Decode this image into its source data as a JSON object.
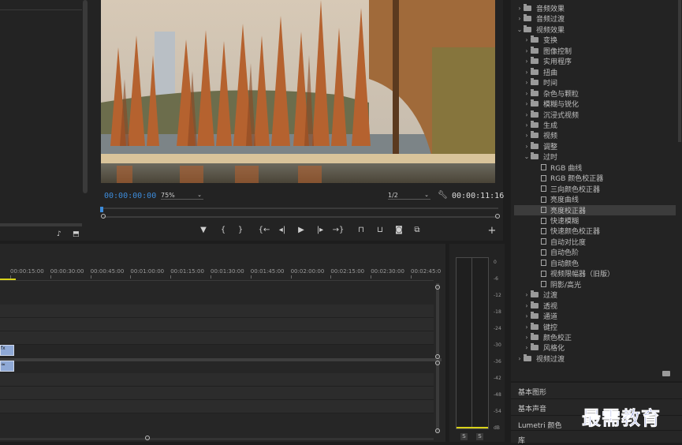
{
  "program_monitor": {
    "timecode_current": "00:00:00:00",
    "zoom_level": "75%",
    "resolution": "1/2",
    "timecode_duration": "00:00:11:16",
    "playhead_fraction": 0.0,
    "controls": {
      "marker": "▼",
      "in": "{",
      "out": "}",
      "goto_in": "{←",
      "step_back": "◂|",
      "play": "▶",
      "step_forward": "|▸",
      "goto_out": "→}",
      "lift": "⊓",
      "extract": "⊔",
      "export_frame": "◙",
      "compare": "⧉",
      "add": "+"
    }
  },
  "timeline": {
    "ruler_labels": [
      "00:00:15:00",
      "00:00:30:00",
      "00:00:45:00",
      "00:01:00:00",
      "00:01:15:00",
      "00:01:30:00",
      "00:01:45:00",
      "00:02:00:00",
      "00:02:15:00",
      "00:02:30:00",
      "00:02:45:0"
    ],
    "clip_video_label": "fx",
    "clip_audio_label": "≈"
  },
  "audio_meter": {
    "scale": [
      "0",
      "-6",
      "-12",
      "-18",
      "-24",
      "-30",
      "-36",
      "-42",
      "-48",
      "-54",
      "dB"
    ],
    "solo_left": "S",
    "solo_right": "S"
  },
  "effects_panel": {
    "items": [
      {
        "label": "音频效果",
        "level": 0,
        "type": "folder",
        "expanded": false
      },
      {
        "label": "音频过渡",
        "level": 0,
        "type": "folder",
        "expanded": false
      },
      {
        "label": "视频效果",
        "level": 0,
        "type": "folder",
        "expanded": true
      },
      {
        "label": "变换",
        "level": 1,
        "type": "folder",
        "expanded": false
      },
      {
        "label": "图像控制",
        "level": 1,
        "type": "folder",
        "expanded": false
      },
      {
        "label": "实用程序",
        "level": 1,
        "type": "folder",
        "expanded": false
      },
      {
        "label": "扭曲",
        "level": 1,
        "type": "folder",
        "expanded": false
      },
      {
        "label": "时间",
        "level": 1,
        "type": "folder",
        "expanded": false
      },
      {
        "label": "杂色与颗粒",
        "level": 1,
        "type": "folder",
        "expanded": false
      },
      {
        "label": "模糊与锐化",
        "level": 1,
        "type": "folder",
        "expanded": false
      },
      {
        "label": "沉浸式视频",
        "level": 1,
        "type": "folder",
        "expanded": false
      },
      {
        "label": "生成",
        "level": 1,
        "type": "folder",
        "expanded": false
      },
      {
        "label": "视频",
        "level": 1,
        "type": "folder",
        "expanded": false
      },
      {
        "label": "调整",
        "level": 1,
        "type": "folder",
        "expanded": false
      },
      {
        "label": "过时",
        "level": 1,
        "type": "folder",
        "expanded": true
      },
      {
        "label": "RGB 曲线",
        "level": 2,
        "type": "effect"
      },
      {
        "label": "RGB 颜色校正器",
        "level": 2,
        "type": "effect"
      },
      {
        "label": "三向颜色校正器",
        "level": 2,
        "type": "effect"
      },
      {
        "label": "亮度曲线",
        "level": 2,
        "type": "effect"
      },
      {
        "label": "亮度校正器",
        "level": 2,
        "type": "effect",
        "selected": true
      },
      {
        "label": "快速模糊",
        "level": 2,
        "type": "effect"
      },
      {
        "label": "快速颜色校正器",
        "level": 2,
        "type": "effect"
      },
      {
        "label": "自动对比度",
        "level": 2,
        "type": "effect"
      },
      {
        "label": "自动色阶",
        "level": 2,
        "type": "effect"
      },
      {
        "label": "自动颜色",
        "level": 2,
        "type": "effect"
      },
      {
        "label": "视频限幅器（旧版）",
        "level": 2,
        "type": "effect"
      },
      {
        "label": "阴影/高光",
        "level": 2,
        "type": "effect"
      },
      {
        "label": "过渡",
        "level": 1,
        "type": "folder",
        "expanded": false
      },
      {
        "label": "透视",
        "level": 1,
        "type": "folder",
        "expanded": false
      },
      {
        "label": "通道",
        "level": 1,
        "type": "folder",
        "expanded": false
      },
      {
        "label": "键控",
        "level": 1,
        "type": "folder",
        "expanded": false
      },
      {
        "label": "颜色校正",
        "level": 1,
        "type": "folder",
        "expanded": false
      },
      {
        "label": "风格化",
        "level": 1,
        "type": "folder",
        "expanded": false
      },
      {
        "label": "视频过渡",
        "level": 0,
        "type": "folder",
        "expanded": false
      }
    ]
  },
  "side_panels": [
    "基本图形",
    "基本声音",
    "Lumetri 颜色",
    "库"
  ],
  "watermark": "最需教育",
  "colors": {
    "accent_blue": "#3d8bd9",
    "selected_row": "#3c3c3c",
    "clip_blue": "#8fa9d6",
    "playhead": "#d8d21a"
  }
}
